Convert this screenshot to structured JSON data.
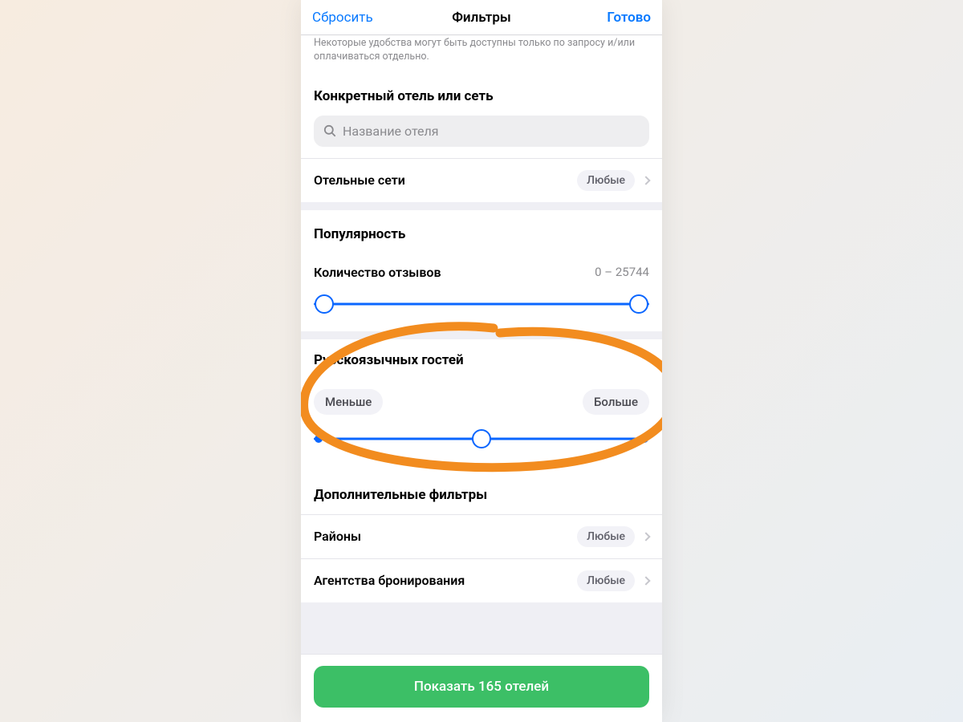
{
  "nav": {
    "reset": "Сбросить",
    "title": "Фильтры",
    "done": "Готово"
  },
  "disclaimer": "Некоторые удобства могут быть доступны только по запросу и/или оплачиваться отдельно.",
  "hotel_section": {
    "title": "Конкретный отель или сеть",
    "search_placeholder": "Название отеля",
    "chains_label": "Отельные сети",
    "chains_value": "Любые"
  },
  "popularity": {
    "title": "Популярность",
    "reviews_label": "Количество отзывов",
    "reviews_range": "0 – 25744"
  },
  "russian_guests": {
    "title": "Русскоязычных гостей",
    "less": "Меньше",
    "more": "Больше"
  },
  "extra": {
    "title": "Дополнительные фильтры",
    "districts_label": "Районы",
    "districts_value": "Любые",
    "agencies_label": "Агентства бронирования",
    "agencies_value": "Любые"
  },
  "cta": "Показать 165 отелей",
  "colors": {
    "accent_blue": "#0a7aff",
    "slider_blue": "#0a66ff",
    "cta_green": "#3cbf66",
    "annotation_orange": "#f28c1f"
  }
}
